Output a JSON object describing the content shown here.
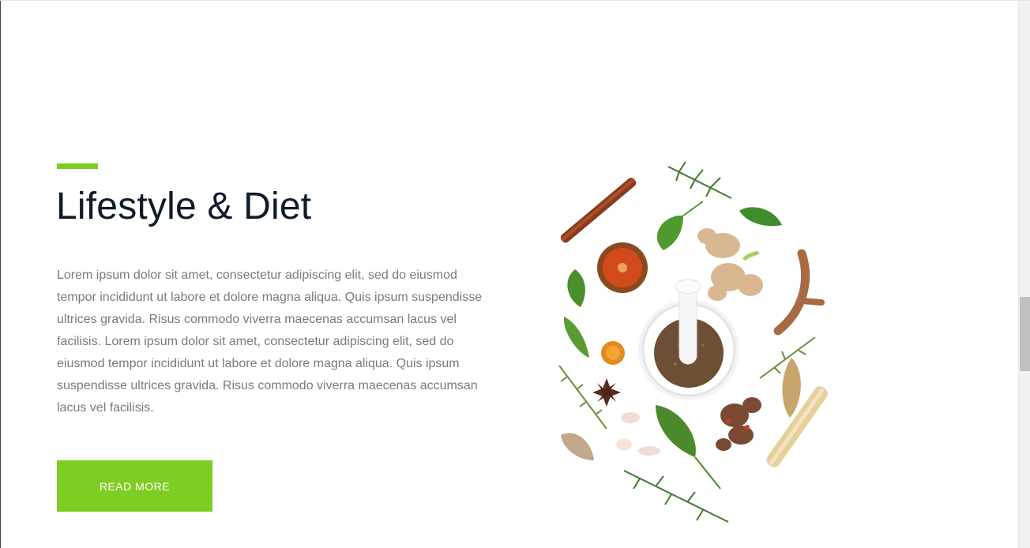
{
  "section": {
    "title": "Lifestyle & Diet",
    "body": "Lorem ipsum dolor sit amet, consectetur adipiscing elit, sed do eiusmod tempor incididunt ut labore et dolore magna aliqua. Quis ipsum suspendisse ultrices gravida. Risus commodo viverra maecenas accumsan lacus vel facilisis. Lorem ipsum dolor sit amet, consectetur adipiscing elit, sed do eiusmod tempor incididunt ut labore et dolore magna aliqua. Quis ipsum suspendisse ultrices gravida. Risus commodo viverra maecenas accumsan lacus vel facilisis.",
    "button_label": "READ MORE"
  },
  "colors": {
    "accent": "#7ecd23",
    "title": "#0f1a2a",
    "body": "#7a7a7a"
  },
  "illustration": {
    "icon": "herbs-spices-mortar-icon"
  }
}
